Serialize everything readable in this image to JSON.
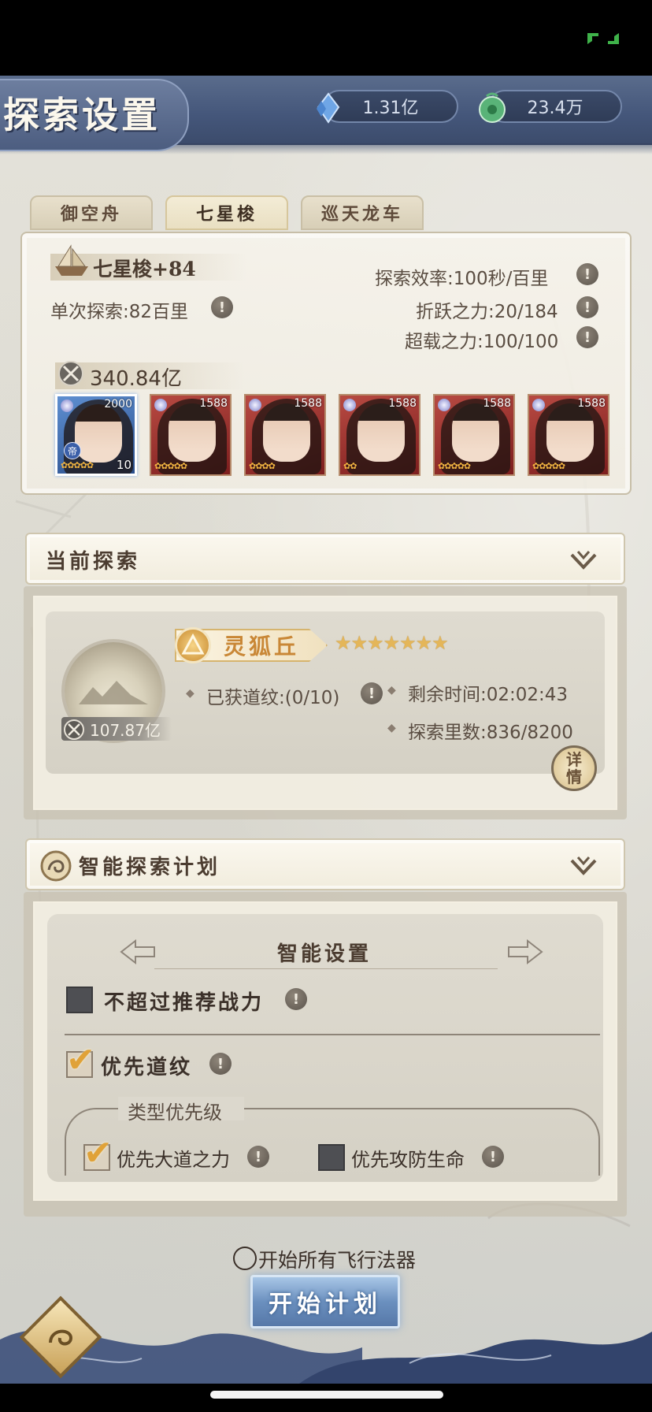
{
  "header": {
    "title": "探索设置",
    "resources": [
      {
        "icon": "spirit-crystal-icon",
        "value": "1.31亿"
      },
      {
        "icon": "jade-coin-icon",
        "value": "23.4万"
      }
    ]
  },
  "tabs": [
    {
      "label": "御空舟",
      "active": false
    },
    {
      "label": "七星梭",
      "active": true
    },
    {
      "label": "巡天龙车",
      "active": false
    }
  ],
  "ship": {
    "name": "七星梭+84",
    "single_explore": "单次探索:82百里",
    "efficiency": "探索效率:100秒/百里",
    "jump_power": "折跃之力:20/184",
    "overload_power": "超载之力:100/100",
    "combat_power": "340.84亿",
    "heroes": [
      {
        "level": "2000",
        "count": "10",
        "badge": "帝",
        "selected": true
      },
      {
        "level": "1588"
      },
      {
        "level": "1588"
      },
      {
        "level": "1588"
      },
      {
        "level": "1588"
      },
      {
        "level": "1588"
      }
    ]
  },
  "current_explore": {
    "title": "当前探索",
    "zone_name": "灵狐丘",
    "zone_stars": "★★★★★★★",
    "power": "107.87亿",
    "runes": "已获道纹:(0/10)",
    "remaining": "剩余时间:02:02:43",
    "distance": "探索里数:836/8200",
    "detail_label": "详情"
  },
  "smart_plan": {
    "title": "智能探索计划",
    "settings_title": "智能设置",
    "opt_no_exceed": {
      "label": "不超过推荐战力",
      "checked": false
    },
    "opt_prefer_runes": {
      "label": "优先道纹",
      "checked": true
    },
    "priority_title": "类型优先级",
    "opt_dao_power": {
      "label": "优先大道之力",
      "checked": true
    },
    "opt_attack_def": {
      "label": "优先攻防生命",
      "checked": false
    }
  },
  "footer": {
    "start_all_label": "开始所有飞行法器",
    "start_button": "开始计划"
  },
  "colors": {
    "header_blue": "#44567a",
    "accent_gold": "#e0a238",
    "button_blue": "#6b90bf"
  }
}
